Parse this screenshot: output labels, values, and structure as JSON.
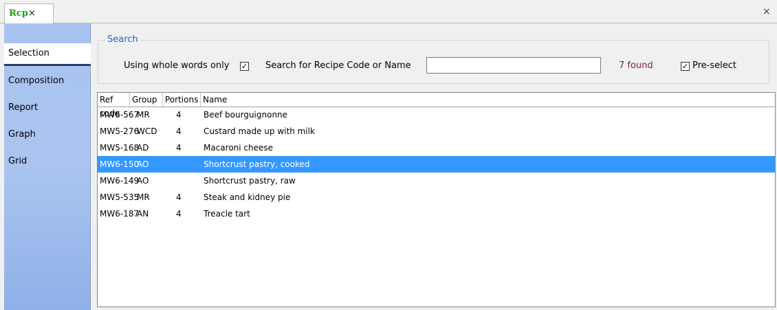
{
  "tab": {
    "title": "Rcp",
    "close_glyph": "×"
  },
  "window": {
    "close_glyph": "×"
  },
  "nav": {
    "items": [
      "Selection",
      "Composition",
      "Report",
      "Graph",
      "Grid"
    ],
    "active": "Selection"
  },
  "search": {
    "legend": "Search",
    "whole_words_label": "Using whole words only",
    "whole_words_checked": true,
    "search_label": "Search for Recipe Code or Name",
    "search_value": "",
    "found_text": "7 found",
    "preselect_label": "Pre-select",
    "preselect_checked": true
  },
  "table": {
    "headers": [
      "Ref code",
      "Group",
      "Portions",
      "Name"
    ],
    "rows": [
      {
        "ref": "MW6-567",
        "group": "MR",
        "portions": "4",
        "name": "Beef bourguignonne",
        "selected": false
      },
      {
        "ref": "MW5-276",
        "group": "WCD",
        "portions": "4",
        "name": "Custard made up with milk",
        "selected": false
      },
      {
        "ref": "MW5-168",
        "group": "AD",
        "portions": "4",
        "name": "Macaroni cheese",
        "selected": false
      },
      {
        "ref": "MW6-150",
        "group": "AO",
        "portions": "",
        "name": "Shortcrust pastry, cooked",
        "selected": true
      },
      {
        "ref": "MW6-149",
        "group": "AO",
        "portions": "",
        "name": "Shortcrust pastry, raw",
        "selected": false
      },
      {
        "ref": "MW5-535",
        "group": "MR",
        "portions": "4",
        "name": "Steak and kidney pie",
        "selected": false
      },
      {
        "ref": "MW6-187",
        "group": "AN",
        "portions": "4",
        "name": "Treacle tart",
        "selected": false
      }
    ]
  },
  "colors": {
    "selection": "#3399ff",
    "tab_title": "#1aa01a",
    "legend": "#1f63c7",
    "found": "#8b1a4c"
  }
}
